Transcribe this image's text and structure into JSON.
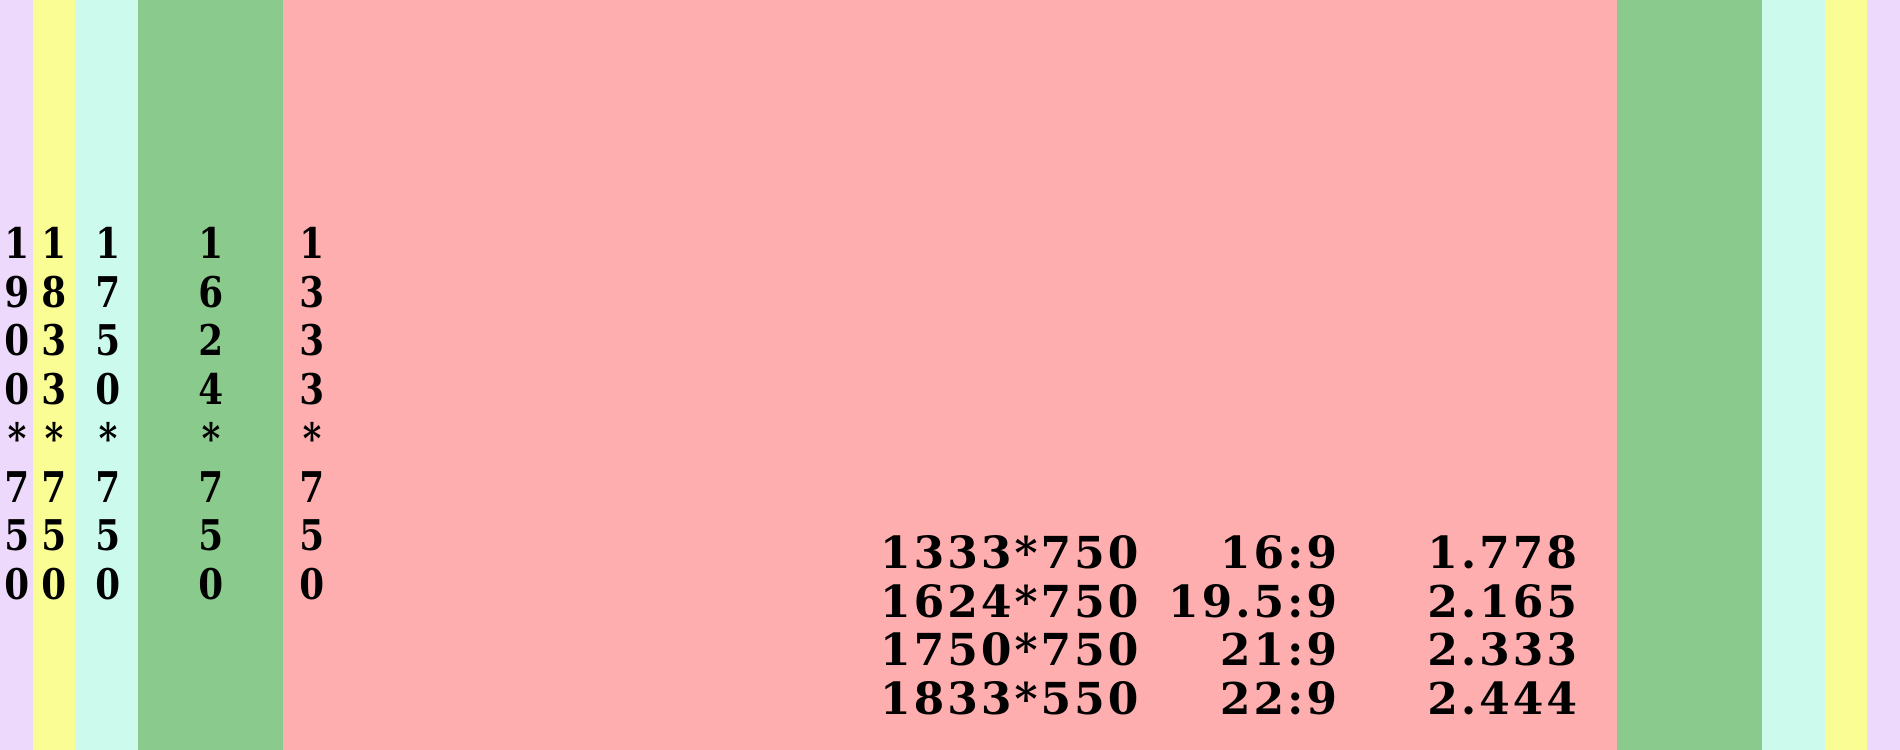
{
  "bands": [
    {
      "name": "1900*750",
      "color": "#EDD9FB"
    },
    {
      "name": "1833*750",
      "color": "#FAFD93"
    },
    {
      "name": "1750*750",
      "color": "#CCFBEE"
    },
    {
      "name": "1624*750",
      "color": "#8ACA8C"
    },
    {
      "name": "1333*750",
      "color": "#FFAEAF"
    }
  ],
  "labels": {
    "w1900": "1900*750",
    "w1833": "1833*750",
    "w1750": "1750*750",
    "w1624": "1624*750",
    "w1333": "1333*750"
  },
  "ratio_table": [
    {
      "resolution": "1333*750",
      "ratio": "16:9",
      "decimal": "1.778"
    },
    {
      "resolution": "1624*750",
      "ratio": "19.5:9",
      "decimal": "2.165"
    },
    {
      "resolution": "1750*750",
      "ratio": "21:9",
      "decimal": "2.333"
    },
    {
      "resolution": "1833*550",
      "ratio": "22:9",
      "decimal": "2.444"
    }
  ]
}
